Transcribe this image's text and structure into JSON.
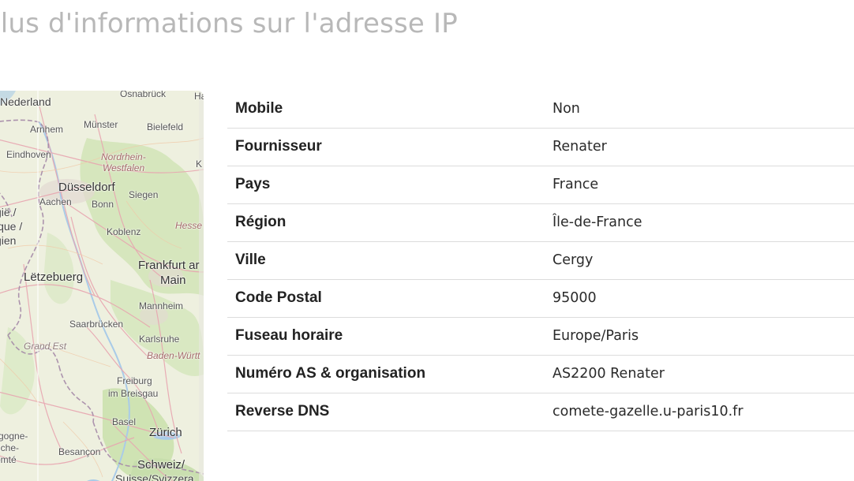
{
  "page": {
    "title": "Plus d'informations sur l'adresse IP"
  },
  "map": {
    "labels": {
      "nederland": "Nederland",
      "osnabruck": "Osnabrück",
      "ha": "Ha",
      "arnhem": "Arnhem",
      "munster": "Münster",
      "bielefeld": "Bielefeld",
      "eindhoven": "Eindhoven",
      "nordrhein": "Nordrhein-",
      "westfalen": "Westfalen",
      "k": "K",
      "dusseldorf": "Düsseldorf",
      "aachen": "Aachen",
      "bonn": "Bonn",
      "siegen": "Siegen",
      "gie": "gië /",
      "ique": "ique /",
      "gien": "gien",
      "koblenz": "Koblenz",
      "hesse": "Hesse",
      "frankfurt": "Frankfurt ar",
      "main": "Main",
      "letzebuerg": "Lëtzebuerg",
      "mannheim": "Mannheim",
      "saarbrucken": "Saarbrücken",
      "grand_est": "Grand Est",
      "karlsruhe": "Karlsruhe",
      "baden": "Baden-Württ",
      "freiburg": "Freiburg",
      "im_breisgau": "im Breisgau",
      "basel": "Basel",
      "zurich": "Zürich",
      "rgogne": "rgogne-",
      "nche": "nche-",
      "omte": "omté",
      "besancon": "Besançon",
      "schweiz": "Schweiz/",
      "suisse": "Suisse/Svizzera"
    }
  },
  "info": {
    "rows": [
      {
        "label": "Mobile",
        "value": "Non"
      },
      {
        "label": "Fournisseur",
        "value": "Renater"
      },
      {
        "label": "Pays",
        "value": "France"
      },
      {
        "label": "Région",
        "value": "Île-de-France"
      },
      {
        "label": "Ville",
        "value": "Cergy"
      },
      {
        "label": "Code Postal",
        "value": "95000"
      },
      {
        "label": "Fuseau horaire",
        "value": "Europe/Paris"
      },
      {
        "label": "Numéro AS & organisation",
        "value": "AS2200 Renater"
      },
      {
        "label": "Reverse DNS",
        "value": "comete-gazelle.u-paris10.fr"
      }
    ]
  },
  "colors": {
    "title": "#b8b8b8",
    "text": "#222222",
    "divider": "#dcdcdc",
    "map_land": "#eef0df",
    "map_forest": "#cfe3b4",
    "map_border": "#a58aa8",
    "map_road": "#e8a5b0",
    "map_water": "#a9cbe8"
  }
}
